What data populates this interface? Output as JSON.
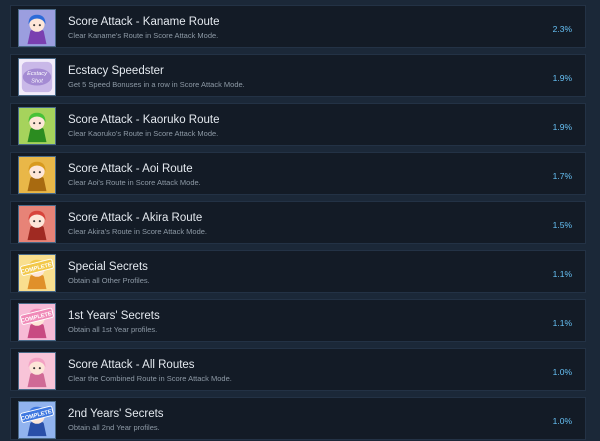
{
  "achievements": [
    {
      "title": "Score Attack - Kaname Route",
      "description": "Clear Kaname's Route in Score Attack Mode.",
      "percent": "2.3%",
      "icon": "kaname-portrait-icon",
      "icon_colors": [
        "#2d6bd8",
        "#f6c9e6",
        "#7a3fb0"
      ]
    },
    {
      "title": "Ecstacy Speedster",
      "description": "Get 5 Speed Bonuses in a row in Score Attack Mode.",
      "percent": "1.9%",
      "icon": "ecstacy-shot-logo-icon",
      "icon_colors": [
        "#c9b8e8",
        "#f2ecfa",
        "#8c6cc4"
      ],
      "icon_text": "Ecstacy Shot"
    },
    {
      "title": "Score Attack - Kaoruko Route",
      "description": "Clear Kaoruko's Route in Score Attack Mode.",
      "percent": "1.9%",
      "icon": "kaoruko-portrait-icon",
      "icon_colors": [
        "#48c238",
        "#f4e27a",
        "#2b8c20"
      ]
    },
    {
      "title": "Score Attack - Aoi Route",
      "description": "Clear Aoi's Route in Score Attack Mode.",
      "percent": "1.7%",
      "icon": "aoi-portrait-icon",
      "icon_colors": [
        "#d89a1e",
        "#f7cf6a",
        "#a86a10"
      ]
    },
    {
      "title": "Score Attack - Akira Route",
      "description": "Clear Akira's Route in Score Attack Mode.",
      "percent": "1.5%",
      "icon": "akira-portrait-icon",
      "icon_colors": [
        "#d8443c",
        "#f4b6a8",
        "#a02a22"
      ]
    },
    {
      "title": "Special Secrets",
      "description": "Obtain all Other Profiles.",
      "percent": "1.1%",
      "icon": "complete-stamp-icon",
      "icon_colors": [
        "#f2c84a",
        "#fff3c8",
        "#e0902a"
      ],
      "icon_text": "COMPLETE!"
    },
    {
      "title": "1st Years' Secrets",
      "description": "Obtain all 1st Year profiles.",
      "percent": "1.1%",
      "icon": "complete-stamp-icon",
      "icon_colors": [
        "#f08ab8",
        "#fde4ef",
        "#c84a82"
      ],
      "icon_text": "COMPLETE!"
    },
    {
      "title": "Score Attack - All Routes",
      "description": "Clear the Combined Route in Score Attack Mode.",
      "percent": "1.0%",
      "icon": "all-routes-portrait-icon",
      "icon_colors": [
        "#f3a2c4",
        "#fbe0ea",
        "#d06a96"
      ]
    },
    {
      "title": "2nd Years' Secrets",
      "description": "Obtain all 2nd Year profiles.",
      "percent": "1.0%",
      "icon": "complete-stamp-icon",
      "icon_colors": [
        "#3f78e0",
        "#d6e4fb",
        "#2a4fa8"
      ],
      "icon_text": "COMPLETE!"
    }
  ]
}
